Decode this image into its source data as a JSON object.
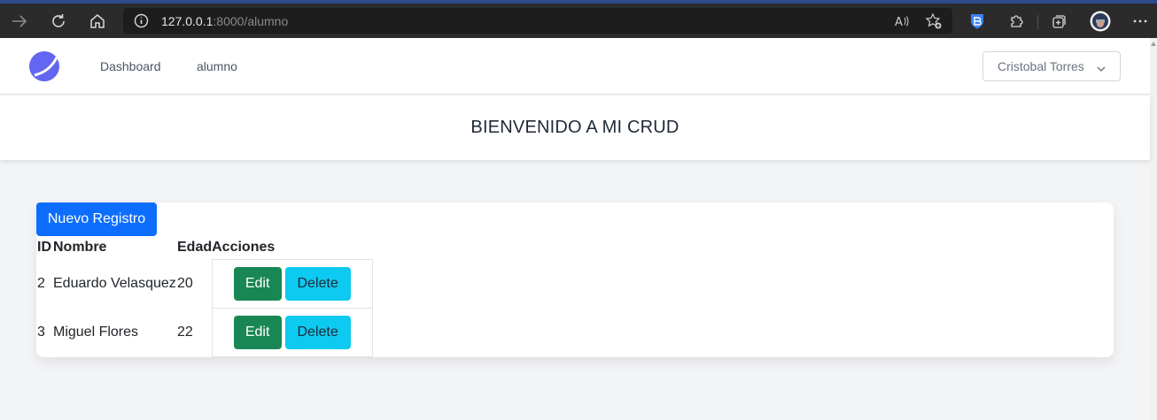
{
  "browser": {
    "url_host": "127.0.0.1",
    "url_rest": ":8000/alumno"
  },
  "nav": {
    "links": [
      "Dashboard",
      "alumno"
    ],
    "user": "Cristobal Torres"
  },
  "header": {
    "title": "BIENVENIDO A MI CRUD"
  },
  "content": {
    "new_button": "Nuevo Registro",
    "columns": [
      "ID",
      "Nombre",
      "Edad",
      "Acciones"
    ],
    "rows": [
      {
        "id": "2",
        "nombre": "Eduardo Velasquez",
        "edad": "20",
        "edit": "Edit",
        "delete": "Delete"
      },
      {
        "id": "3",
        "nombre": "Miguel Flores",
        "edad": "22",
        "edit": "Edit",
        "delete": "Delete"
      }
    ]
  },
  "colors": {
    "primary": "#0d6efd",
    "success": "#198754",
    "info": "#0dcaf0",
    "logo": "#6366f1"
  }
}
